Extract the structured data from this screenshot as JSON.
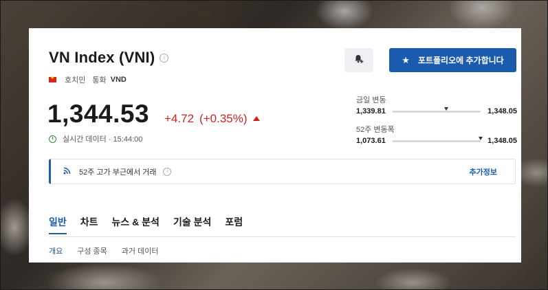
{
  "header": {
    "title": "VN Index (VNI)",
    "city": "호치민",
    "currency_label": "통화",
    "currency": "VND"
  },
  "quote": {
    "price": "1,344.53",
    "change": "+4.72",
    "change_pct": "(+0.35%)",
    "status": "실시간 데이터 · 15:44:00"
  },
  "actions": {
    "portfolio_label": "포트폴리오에 추가합니다"
  },
  "ranges": {
    "day_label": "금일 변동",
    "day_low": "1,339.81",
    "day_high": "1,348.05",
    "day_position": 0.61,
    "week52_label": "52주 변동폭",
    "week52_low": "1,073.61",
    "week52_high": "1,348.05",
    "week52_position": 1.0
  },
  "banner": {
    "text": "52주 고가 부근에서 거래",
    "more_label": "추가정보"
  },
  "tabs": [
    "일반",
    "차트",
    "뉴스 & 분석",
    "기술 분석",
    "포럼"
  ],
  "subtabs": [
    "개요",
    "구성 종목",
    "과거 데이터"
  ],
  "colors": {
    "accent": "#1a5bad",
    "negative_red": "#d0211c",
    "realtime_green": "#2e8b3d"
  }
}
